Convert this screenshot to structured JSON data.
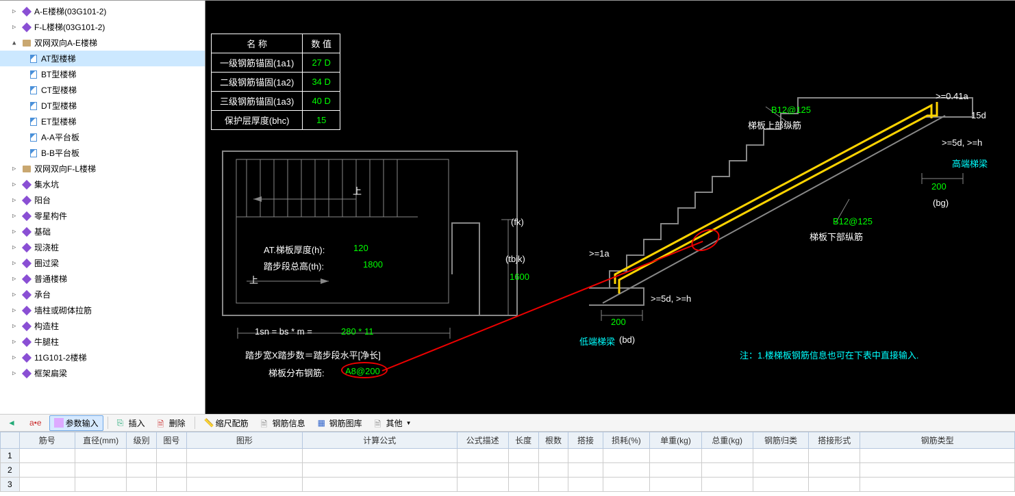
{
  "tree": [
    {
      "icon": "purple",
      "label": "A-E楼梯(03G101-2)",
      "toggle": "▷"
    },
    {
      "icon": "purple",
      "label": "F-L楼梯(03G101-2)",
      "toggle": "▷"
    },
    {
      "icon": "book",
      "label": "双网双向A-E楼梯",
      "toggle": "▲",
      "expanded": true,
      "children": [
        {
          "icon": "page",
          "label": "AT型楼梯",
          "selected": true
        },
        {
          "icon": "page",
          "label": "BT型楼梯"
        },
        {
          "icon": "page",
          "label": "CT型楼梯"
        },
        {
          "icon": "page",
          "label": "DT型楼梯"
        },
        {
          "icon": "page",
          "label": "ET型楼梯"
        },
        {
          "icon": "page",
          "label": "A-A平台板"
        },
        {
          "icon": "page",
          "label": "B-B平台板"
        }
      ]
    },
    {
      "icon": "book",
      "label": "双网双向F-L楼梯",
      "toggle": "▷"
    },
    {
      "icon": "purple",
      "label": "集水坑",
      "toggle": "▷"
    },
    {
      "icon": "purple",
      "label": "阳台",
      "toggle": "▷"
    },
    {
      "icon": "purple",
      "label": "零星构件",
      "toggle": "▷"
    },
    {
      "icon": "purple",
      "label": "基础",
      "toggle": "▷"
    },
    {
      "icon": "purple",
      "label": "现浇桩",
      "toggle": "▷"
    },
    {
      "icon": "purple",
      "label": "圈过梁",
      "toggle": "▷"
    },
    {
      "icon": "purple",
      "label": "普通楼梯",
      "toggle": "▷"
    },
    {
      "icon": "purple",
      "label": "承台",
      "toggle": "▷"
    },
    {
      "icon": "purple",
      "label": "墙柱或砌体拉筋",
      "toggle": "▷"
    },
    {
      "icon": "purple",
      "label": "构造柱",
      "toggle": "▷"
    },
    {
      "icon": "purple",
      "label": "牛腿柱",
      "toggle": "▷"
    },
    {
      "icon": "purple",
      "label": "11G101-2楼梯",
      "toggle": "▷"
    },
    {
      "icon": "purple",
      "label": "框架扁梁",
      "toggle": "▷"
    }
  ],
  "param_rows": [
    {
      "name": "一级钢筋锚固(1a1)",
      "val": "27 D"
    },
    {
      "name": "二级钢筋锚固(1a2)",
      "val": "34 D"
    },
    {
      "name": "三级钢筋锚固(1a3)",
      "val": "40 D"
    },
    {
      "name": "保护层厚度(bhc)",
      "val": "15"
    }
  ],
  "param_hdr": {
    "c1": "名    称",
    "c2": "数    值"
  },
  "plan": {
    "h_label": "AT.梯板厚度(h):",
    "h_val": "120",
    "th_label": "踏步段总高(th):",
    "th_val": "1800",
    "up": "上",
    "fk": "(fk)",
    "tbjk": "(tbjk)",
    "tbjk_val": "1600",
    "lsn": "1sn = bs * m = ",
    "lsn_val": "280 * 11",
    "formula": "踏步宽X踏步数＝踏步段水平[净长]",
    "dist_label": "梯板分布钢筋:",
    "dist_val": "A8@200"
  },
  "section": {
    "top_bar": "B12@125",
    "top_lbl": "梯板上部纵筋",
    "bot_bar": "B12@125",
    "bot_lbl": "梯板下部纵筋",
    "dim_041": ">=0.41a",
    "dim_15d": "15d",
    "dim_5dh": ">=5d, >=h",
    "high_beam": "高端梯梁",
    "low_beam": "低端梯梁",
    "bd": "(bd)",
    "bg": "(bg)",
    "d200a": "200",
    "d200b": "200",
    "ge1a": ">=1a",
    "note": "注：1.楼梯板钢筋信息也可在下表中直接输入."
  },
  "toolbar": {
    "arrow": "",
    "aei": "a•e",
    "param": "参数输入",
    "insert": "插入",
    "delete": "删除",
    "ruler": "缩尺配筋",
    "info": "钢筋信息",
    "lib": "钢筋图库",
    "other": "其他"
  },
  "grid_headers": [
    "筋号",
    "直径(mm)",
    "级别",
    "图号",
    "图形",
    "计算公式",
    "公式描述",
    "长度",
    "根数",
    "搭接",
    "损耗(%)",
    "单重(kg)",
    "总重(kg)",
    "钢筋归类",
    "搭接形式",
    "钢筋类型"
  ],
  "grid_widths": [
    65,
    60,
    35,
    35,
    135,
    180,
    60,
    35,
    35,
    40,
    55,
    60,
    60,
    65,
    60,
    180
  ],
  "rows": [
    1,
    2,
    3
  ]
}
